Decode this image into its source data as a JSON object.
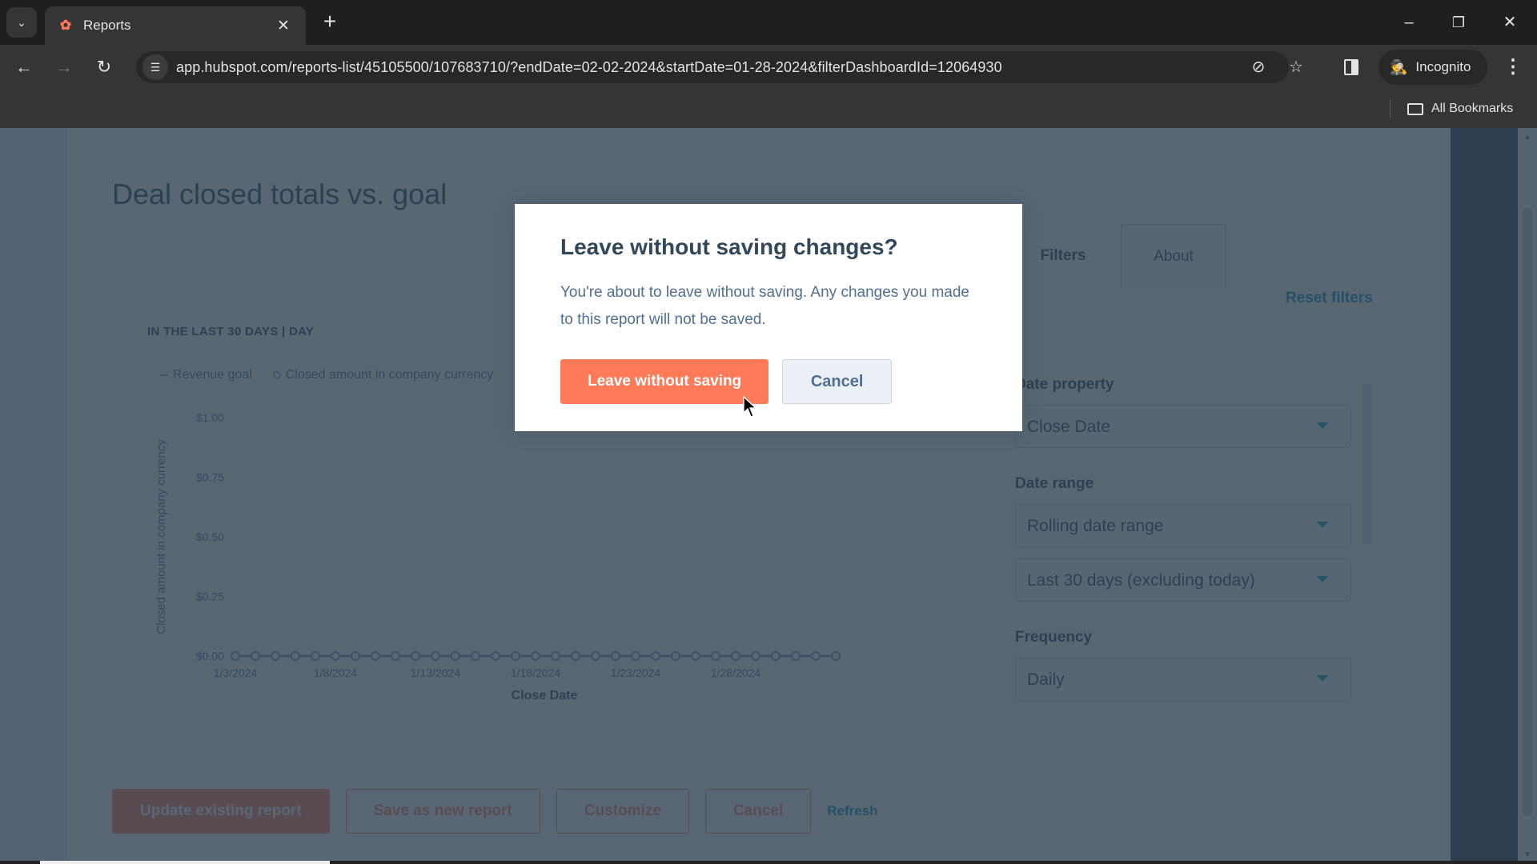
{
  "browser": {
    "tab_title": "Reports",
    "tab_favicon": "hubspot-sprocket-icon",
    "url": "app.hubspot.com/reports-list/45105500/107683710/?endDate=02-02-2024&startDate=01-28-2024&filterDashboardId=12064930",
    "incognito_label": "Incognito",
    "bookmarks_label": "All Bookmarks",
    "accent_color": "#ff7a59"
  },
  "page": {
    "report_title": "Deal closed totals vs. goal",
    "chart_subtitle": "IN THE LAST 30 DAYS | DAY",
    "sidebar": {
      "tabs": [
        {
          "label": "Filters",
          "active": true
        },
        {
          "label": "About",
          "active": false
        }
      ],
      "reset_filters": "Reset filters",
      "filters": [
        {
          "label": "Date property",
          "values": [
            "Close Date"
          ]
        },
        {
          "label": "Date range",
          "values": [
            "Rolling date range",
            "Last 30 days (excluding today)"
          ]
        },
        {
          "label": "Frequency",
          "values": [
            "Daily"
          ]
        }
      ]
    },
    "actions": {
      "update": "Update existing report",
      "save_new": "Save as new report",
      "customize": "Customize",
      "cancel": "Cancel",
      "refresh": "Refresh"
    }
  },
  "chart_data": {
    "type": "line",
    "title": "Deal closed totals vs. goal",
    "subtitle": "IN THE LAST 30 DAYS | DAY",
    "legend": [
      "Revenue goal",
      "Closed amount in company currency"
    ],
    "legend_position": "top-left",
    "xlabel": "Close Date",
    "ylabel": "Closed amount in company currency",
    "x_tick_labels": [
      "1/3/2024",
      "1/8/2024",
      "1/13/2024",
      "1/18/2024",
      "1/23/2024",
      "1/28/2024"
    ],
    "y_tick_labels": [
      "$0.00",
      "$0.25",
      "$0.50",
      "$0.75",
      "$1.00"
    ],
    "ylim": [
      0,
      1
    ],
    "x_start": "1/3/2024",
    "x_end": "2/2/2024",
    "series": [
      {
        "name": "Closed amount in company currency",
        "values": [
          0,
          0,
          0,
          0,
          0,
          0,
          0,
          0,
          0,
          0,
          0,
          0,
          0,
          0,
          0,
          0,
          0,
          0,
          0,
          0,
          0,
          0,
          0,
          0,
          0,
          0,
          0,
          0,
          0,
          0,
          0
        ]
      }
    ],
    "grid": false
  },
  "modal": {
    "title": "Leave without saving changes?",
    "body": "You're about to leave without saving. Any changes you made to this report will not be saved.",
    "confirm_label": "Leave without saving",
    "cancel_label": "Cancel"
  }
}
